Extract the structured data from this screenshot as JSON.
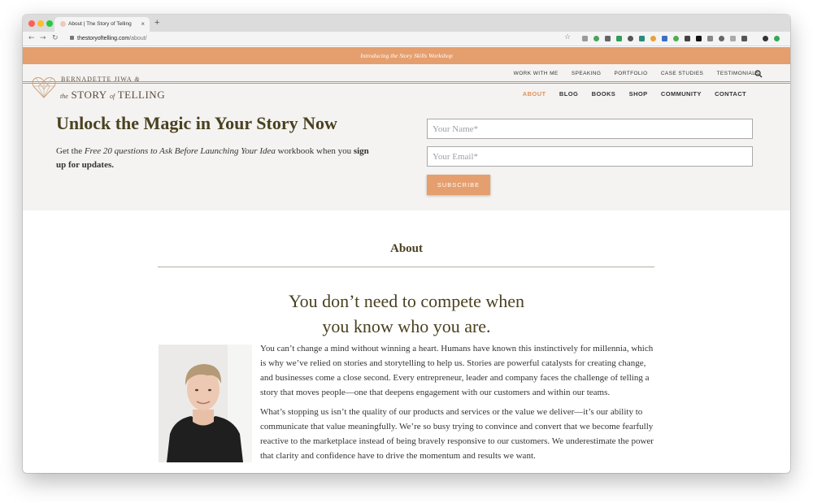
{
  "browser": {
    "tab_title": "About | The Story of Telling",
    "tab_close": "×",
    "new_tab": "+",
    "url_domain": "thestoryoftelling.com",
    "url_path": "/about/"
  },
  "promo": {
    "text": "Introducing the Story Skills Workshop"
  },
  "logo": {
    "author": "BERNADETTE JIWA",
    "amp": "&",
    "the": "the",
    "story": "STORY",
    "of": "of",
    "telling": "TELLING"
  },
  "top_nav": [
    "WORK WITH ME",
    "SPEAKING",
    "PORTFOLIO",
    "CASE STUDIES",
    "TESTIMONIALS"
  ],
  "main_nav": [
    "ABOUT",
    "BLOG",
    "BOOKS",
    "SHOP",
    "COMMUNITY",
    "CONTACT"
  ],
  "hero": {
    "title": "Unlock the Magic in Your Story Now",
    "text_pre": "Get the ",
    "text_italic": "Free 20 questions to Ask Before Launching Your Idea",
    "text_mid": " workbook when you ",
    "text_bold": "sign up for updates.",
    "name_placeholder": "Your Name*",
    "email_placeholder": "Your Email*",
    "subscribe_label": "SUBSCRIBE"
  },
  "content": {
    "heading": "About",
    "tagline_line1": "You don’t need to compete when",
    "tagline_line2": "you know who you are.",
    "paragraph1": "You can’t change a mind without winning a heart. Humans have known this instinctively for millennia, which is why we’ve relied on stories and storytelling to help us. Stories are powerful catalysts for creating change, and businesses come a close second. Every entrepreneur, leader and company faces the challenge of telling a story that moves people—one that deepens engagement with our customers and within our teams.",
    "paragraph2": "What’s stopping us isn’t the quality of our products and services or the value we deliver—it’s our ability to communicate that value meaningfully. We’re so busy trying to convince and convert that we become fearfully reactive to the marketplace instead of being bravely responsive to our customers. We underestimate the power that clarity and confidence have to drive the momentum and results we want."
  },
  "colors": {
    "accent": "#e59e6d",
    "heading": "#4a4120",
    "header_bg": "#f4f3f1"
  }
}
